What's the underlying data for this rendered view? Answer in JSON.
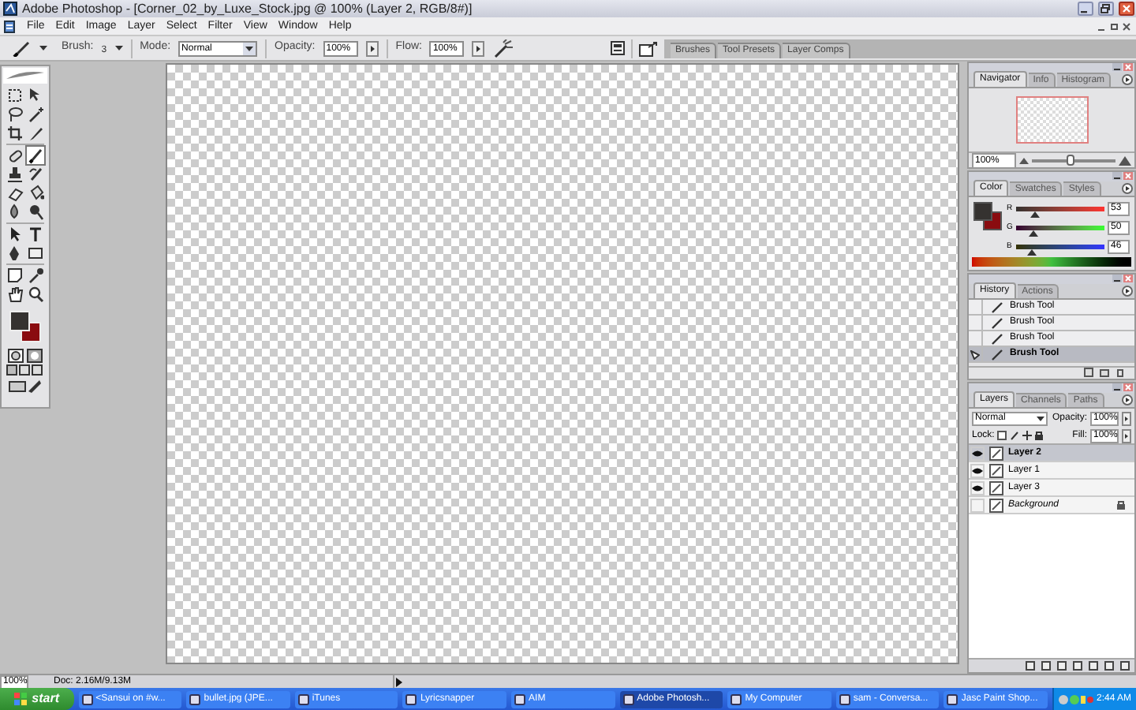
{
  "window": {
    "title": "Adobe Photoshop - [Corner_02_by_Luxe_Stock.jpg @ 100% (Layer 2, RGB/8#)]"
  },
  "menu": [
    "File",
    "Edit",
    "Image",
    "Layer",
    "Select",
    "Filter",
    "View",
    "Window",
    "Help"
  ],
  "options_bar": {
    "brush_label": "Brush:",
    "brush_size": "3",
    "mode_label": "Mode:",
    "mode_value": "Normal",
    "opacity_label": "Opacity:",
    "opacity_value": "100%",
    "flow_label": "Flow:",
    "flow_value": "100%"
  },
  "palette_well": [
    "Brushes",
    "Tool Presets",
    "Layer Comps"
  ],
  "toolbox": {
    "tools": [
      {
        "selected": false
      },
      {
        "selected": false
      },
      {
        "selected": false
      },
      {
        "selected": false
      },
      {
        "selected": false
      },
      {
        "selected": false
      },
      {
        "selected": false
      },
      {
        "selected": true
      },
      {
        "selected": false
      },
      {
        "selected": false
      },
      {
        "selected": false
      },
      {
        "selected": false
      },
      {
        "selected": false
      },
      {
        "selected": false
      },
      {
        "selected": false
      },
      {
        "selected": false
      },
      {
        "selected": false
      },
      {
        "selected": false
      },
      {
        "selected": false
      },
      {
        "selected": false
      },
      {
        "selected": false
      },
      {
        "selected": false
      }
    ]
  },
  "navigator_panel": {
    "tabs": [
      {
        "label": "Navigator",
        "selected": true
      },
      {
        "label": "Info",
        "selected": false
      },
      {
        "label": "Histogram",
        "selected": false
      }
    ],
    "zoom": "100%",
    "zoom_slider": {
      "level": 0.45
    }
  },
  "color_panel": {
    "tabs": [
      {
        "label": "Color",
        "selected": true
      },
      {
        "label": "Swatches",
        "selected": false
      },
      {
        "label": "Styles",
        "selected": false
      }
    ],
    "channels": [
      {
        "name": "R",
        "value": "53",
        "level": 0.21
      },
      {
        "name": "G",
        "value": "50",
        "level": 0.2
      },
      {
        "name": "B",
        "value": "46",
        "level": 0.18
      }
    ]
  },
  "history_panel": {
    "tabs": [
      {
        "label": "History",
        "selected": true
      },
      {
        "label": "Actions",
        "selected": false
      }
    ],
    "items": [
      {
        "label": "Brush Tool",
        "selected": false
      },
      {
        "label": "Brush Tool",
        "selected": false
      },
      {
        "label": "Brush Tool",
        "selected": false
      },
      {
        "label": "Brush Tool",
        "selected": true
      }
    ]
  },
  "layers_panel": {
    "tabs": [
      {
        "label": "Layers",
        "selected": true
      },
      {
        "label": "Channels",
        "selected": false
      },
      {
        "label": "Paths",
        "selected": false
      }
    ],
    "blend_mode": "Normal",
    "opacity_label": "Opacity:",
    "opacity_value": "100%",
    "lock_label": "Lock:",
    "fill_label": "Fill:",
    "fill_value": "100%",
    "layers": [
      {
        "name": "Layer 2",
        "kind": "layer",
        "visible": true,
        "selected": true,
        "locked": false
      },
      {
        "name": "Layer 1",
        "kind": "layer",
        "visible": true,
        "selected": false,
        "locked": false
      },
      {
        "name": "Layer 3",
        "kind": "layer",
        "visible": true,
        "selected": false,
        "locked": false
      },
      {
        "name": "Background",
        "kind": "background",
        "visible": false,
        "selected": false,
        "locked": true
      }
    ]
  },
  "status_bar": {
    "zoom": "100%",
    "doc": "Doc: 2.16M/9.13M"
  },
  "taskbar": {
    "start": "start",
    "items": [
      {
        "label": "<Sansui on #w...",
        "selected": false
      },
      {
        "label": "bullet.jpg (JPE...",
        "selected": false
      },
      {
        "label": "iTunes",
        "selected": false
      },
      {
        "label": "Lyricsnapper",
        "selected": false
      },
      {
        "label": "AIM",
        "selected": false
      },
      {
        "label": "Adobe Photosh...",
        "selected": true
      },
      {
        "label": "My Computer",
        "selected": false
      },
      {
        "label": "sam - Conversa...",
        "selected": false
      },
      {
        "label": "Jasc Paint Shop...",
        "selected": false
      }
    ],
    "clock": "2:44 AM"
  }
}
